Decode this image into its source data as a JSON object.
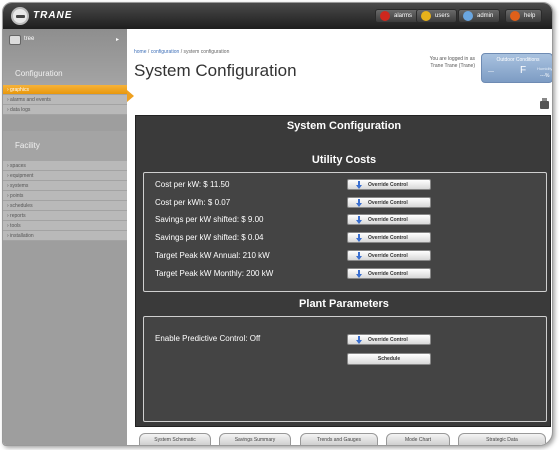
{
  "brand": {
    "name": "TRANE"
  },
  "topbar": {
    "buttons": [
      {
        "label": "alarms",
        "icon": "alarm-icon",
        "color": "#d0281e"
      },
      {
        "label": "users",
        "icon": "user-icon",
        "color": "#e7b21b"
      },
      {
        "label": "admin",
        "icon": "admin-icon",
        "color": "#6aa6e0"
      },
      {
        "label": "help",
        "icon": "help-icon",
        "color": "#e0601a"
      }
    ]
  },
  "sidebar": {
    "tree_label": "tree",
    "tree_arrow": "▸",
    "configuration_heading": "Configuration",
    "config_items": [
      {
        "label": "› graphics",
        "active": true
      },
      {
        "label": "› alarms and events",
        "active": false
      },
      {
        "label": "› data logs",
        "active": false
      }
    ],
    "facility_heading": "Facility",
    "facility_items": [
      {
        "label": "› spaces"
      },
      {
        "label": "› equipment"
      },
      {
        "label": "› systems"
      },
      {
        "label": "› points"
      },
      {
        "label": "› schedules"
      },
      {
        "label": "› reports"
      },
      {
        "label": "› tools"
      },
      {
        "label": "› installation"
      }
    ]
  },
  "header": {
    "breadcrumb": {
      "home": "home",
      "sep1": " / ",
      "configuration": "configuration",
      "sep2": " / ",
      "current": "system configuration"
    },
    "title": "System Configuration",
    "login_line1": "You are logged in as",
    "login_line2": "Trane Trane (Trane)",
    "outdoor": {
      "title": "Outdoor Conditions",
      "value": "---",
      "unit": "F",
      "humidity_label": "Humidity",
      "humidity_value": "---%"
    }
  },
  "panel": {
    "title": "System Configuration",
    "utility": {
      "title": "Utility Costs",
      "rows": [
        {
          "label": "Cost per kW:  $   11.50",
          "button": "Override Control"
        },
        {
          "label": "Cost per kWh:  $   0.07",
          "button": "Override Control"
        },
        {
          "label": "Savings per kW shifted:  $   9.00",
          "button": "Override Control"
        },
        {
          "label": "Savings per kW shifted:  $   0.04",
          "button": "Override Control"
        },
        {
          "label": "Target Peak kW Annual:    210  kW",
          "button": "Override Control"
        },
        {
          "label": "Target Peak kW Monthly:    200  kW",
          "button": "Override Control"
        }
      ]
    },
    "plant": {
      "title": "Plant Parameters",
      "predictive_label": "Enable Predictive Control:   Off",
      "override_button": "Override Control",
      "schedule_button": "Schedule"
    }
  },
  "bottom_tabs": [
    "System Schematic",
    "Savings Summary",
    "Trends and Gauges",
    "Mode Chart",
    "Strategic Data"
  ]
}
